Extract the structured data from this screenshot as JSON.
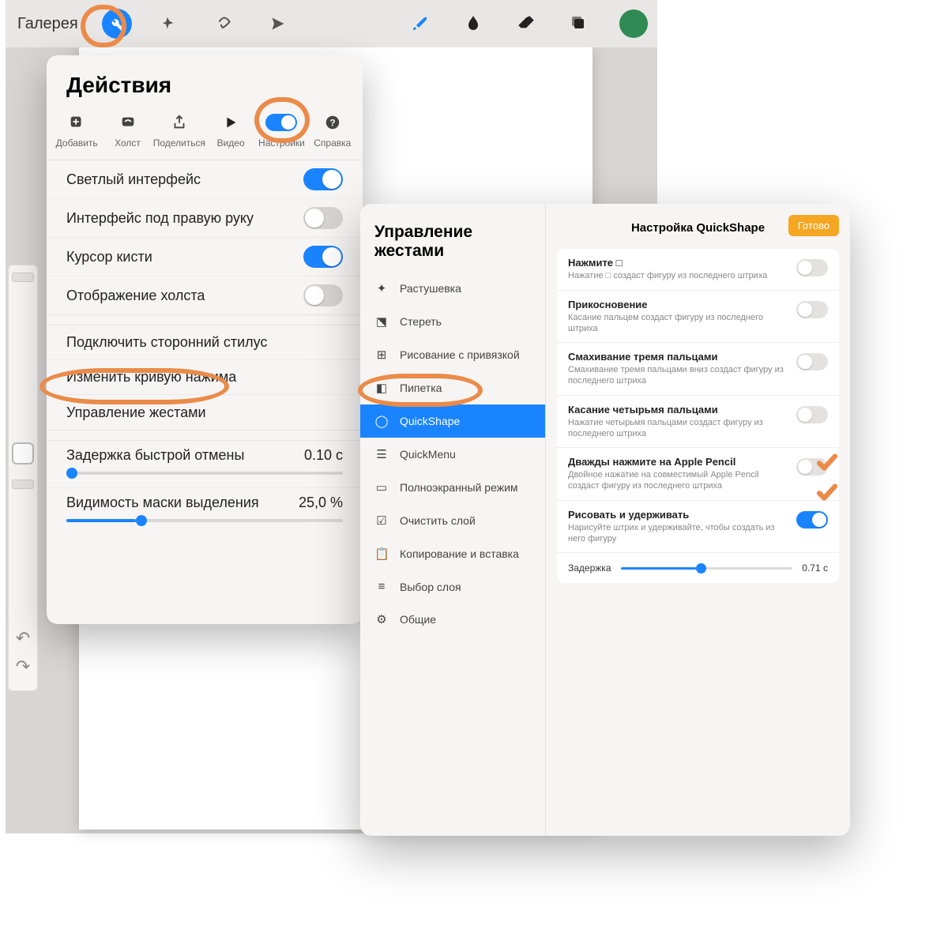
{
  "toolbar": {
    "gallery": "Галерея"
  },
  "actions": {
    "title": "Действия",
    "tabs": {
      "add": "Добавить",
      "canvas": "Холст",
      "share": "Поделиться",
      "video": "Видео",
      "settings": "Настройки",
      "help": "Справка"
    },
    "light_interface": "Светлый интерфейс",
    "right_hand_ui": "Интерфейс под правую руку",
    "brush_cursor": "Курсор кисти",
    "canvas_display": "Отображение холста",
    "third_party_stylus": "Подключить сторонний стилус",
    "pressure_curve": "Изменить кривую нажима",
    "gesture_controls": "Управление жестами",
    "undo_delay_label": "Задержка быстрой отмены",
    "undo_delay_value": "0.10 с",
    "mask_visibility_label": "Видимость маски выделения",
    "mask_visibility_value": "25,0 %"
  },
  "gestures": {
    "title": "Управление жестами",
    "items": {
      "smudge": "Растушевка",
      "erase": "Стереть",
      "assisted": "Рисование с привязкой",
      "eyedropper": "Пипетка",
      "quickshape": "QuickShape",
      "quickmenu": "QuickMenu",
      "fullscreen": "Полноэкранный режим",
      "clear_layer": "Очистить слой",
      "copy_paste": "Копирование и вставка",
      "layer_select": "Выбор слоя",
      "general": "Общие"
    },
    "right_header": "Настройка QuickShape",
    "done": "Готово",
    "options": [
      {
        "title": "Нажмите □",
        "desc": "Нажатие □ создаст фигуру из последнего штриха",
        "on": false
      },
      {
        "title": "Прикосновение",
        "desc": "Касание пальцем создаст фигуру из последнего штриха",
        "on": false
      },
      {
        "title": "Смахивание тремя пальцами",
        "desc": "Смахивание тремя пальцами вниз создаст фигуру из последнего штриха",
        "on": false
      },
      {
        "title": "Касание четырьмя пальцами",
        "desc": "Нажатие четырьмя пальцами создаст фигуру из последнего штриха",
        "on": false
      },
      {
        "title": "Дважды нажмите на Apple Pencil",
        "desc": "Двойное нажатие на совместимый Apple Pencil создаст фигуру из последнего штриха",
        "on": false
      },
      {
        "title": "Рисовать и удерживать",
        "desc": "Нарисуйте штрих и удерживайте, чтобы создать из него фигуру",
        "on": true
      }
    ],
    "delay_label": "Задержка",
    "delay_value": "0.71 с"
  }
}
